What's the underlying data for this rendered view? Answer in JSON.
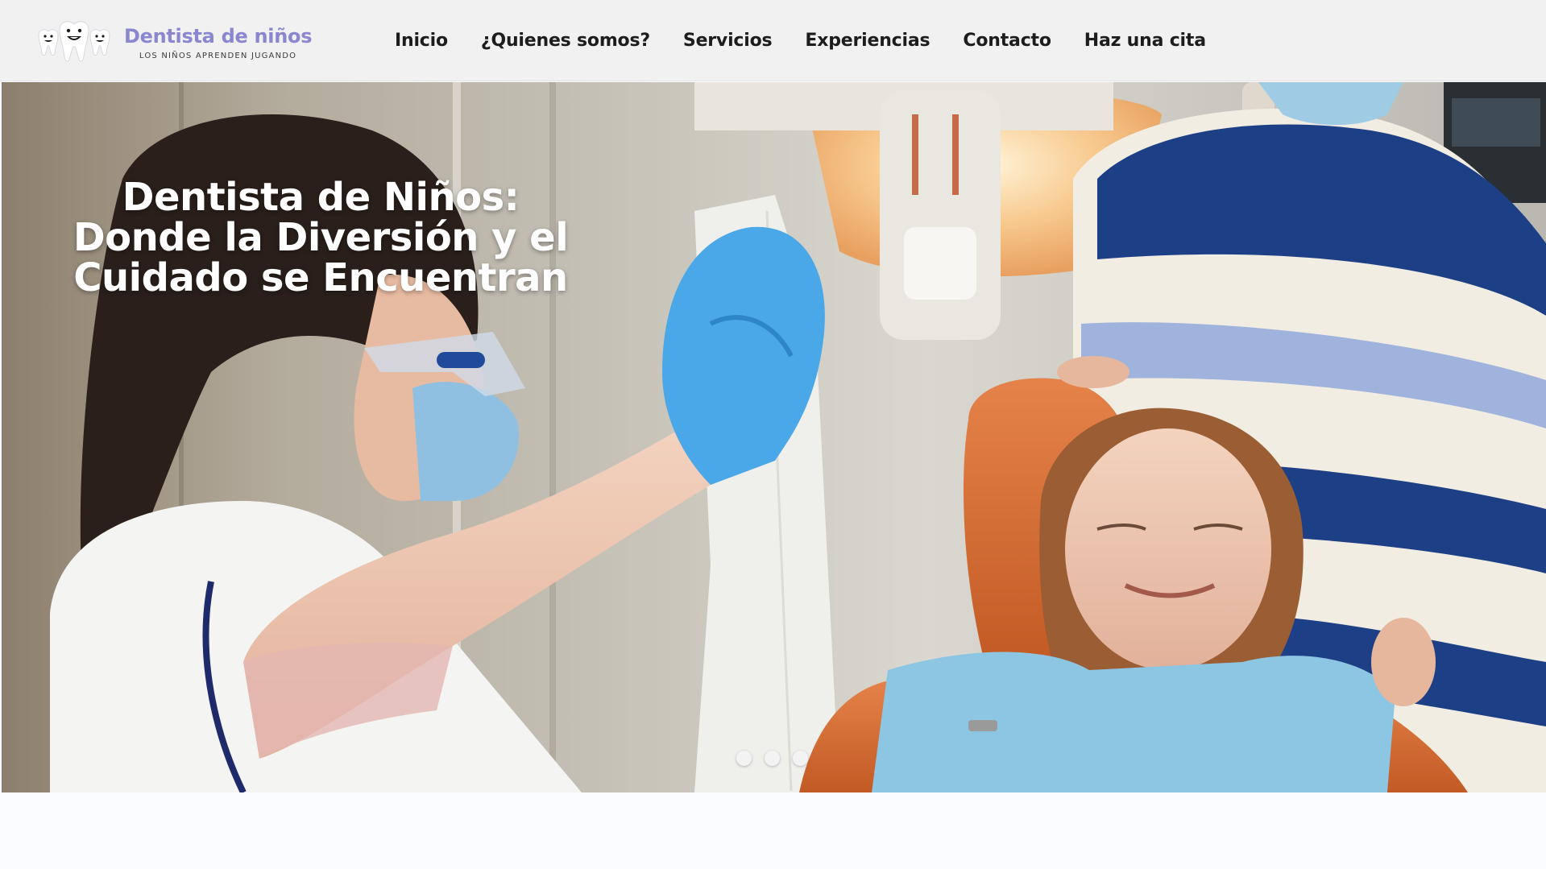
{
  "brand": {
    "name": "Dentista de niños",
    "tagline": "LOS NIÑOS APRENDEN JUGANDO",
    "logo_icon": "smiling-teeth-logo-icon",
    "color": "#8a86d0"
  },
  "nav": {
    "items": [
      {
        "label": "Inicio"
      },
      {
        "label": "¿Quienes somos?"
      },
      {
        "label": "Servicios"
      },
      {
        "label": "Experiencias"
      },
      {
        "label": "Contacto"
      },
      {
        "label": "Haz una cita"
      }
    ]
  },
  "hero": {
    "title": "Dentista de Niños: Donde la Diversión y el Cuidado se Encuentran",
    "image": "dentist-treating-smiling-girl-photo",
    "slides": 3
  }
}
